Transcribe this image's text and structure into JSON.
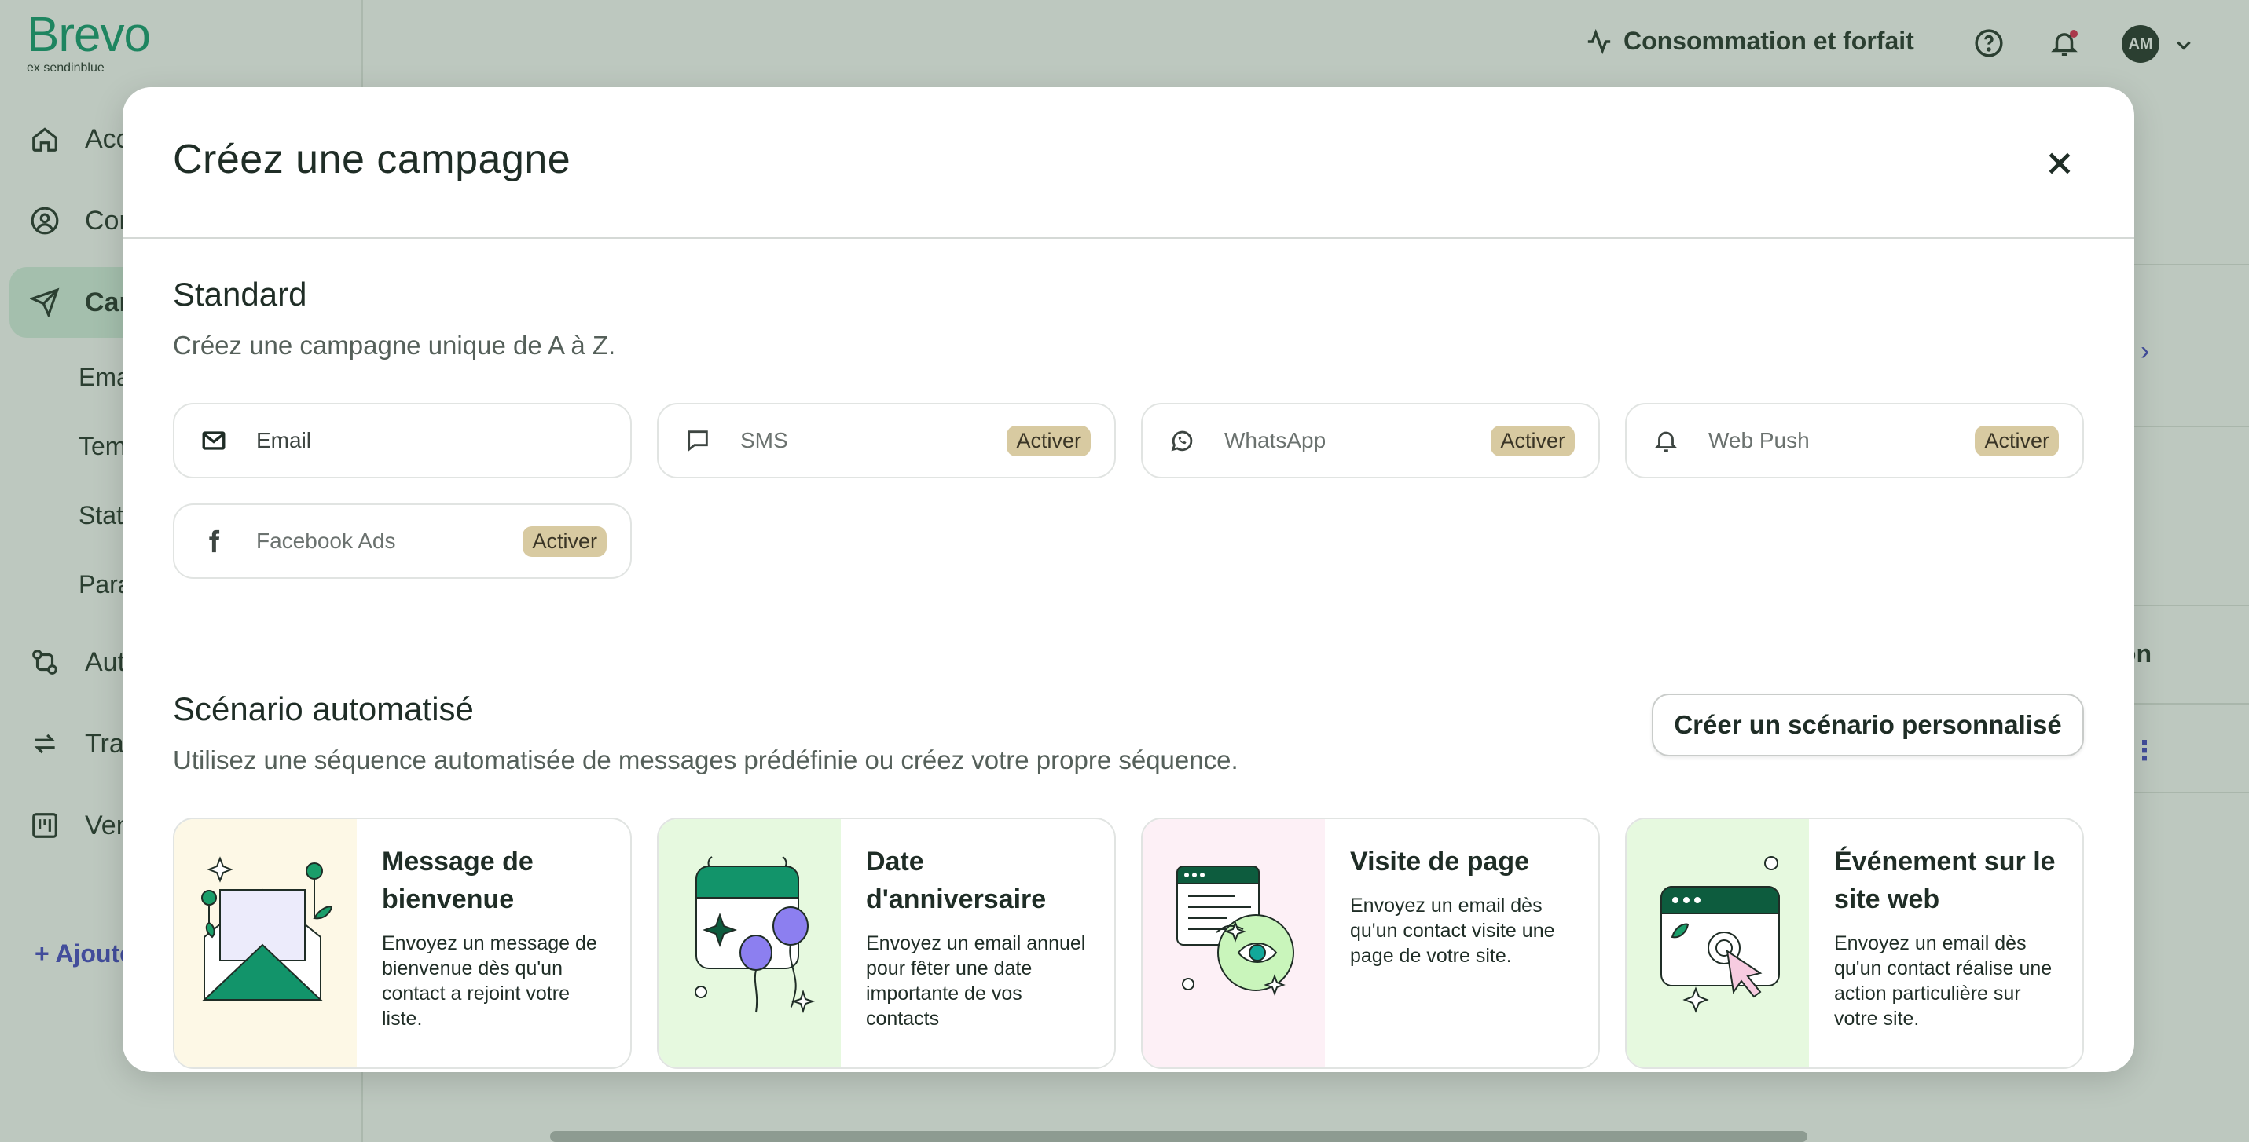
{
  "brand": {
    "name": "Brevo",
    "tagline": "ex sendinblue",
    "color": "#0b996e"
  },
  "sidebar": {
    "items": [
      {
        "label": "Accueil",
        "icon": "home-icon"
      },
      {
        "label": "Contacts",
        "icon": "user-circle-icon"
      },
      {
        "label": "Campagnes",
        "icon": "send-icon",
        "active": true
      },
      {
        "label": "Automatisations",
        "icon": "automation-icon"
      },
      {
        "label": "Transactionnel",
        "icon": "transactional-icon"
      },
      {
        "label": "Ventes",
        "icon": "sales-board-icon"
      }
    ],
    "sub_items": [
      "Emails",
      "Templates",
      "Statistiques",
      "Paramètres"
    ],
    "add_label": "+ Ajouter"
  },
  "topbar": {
    "usage_label": "Consommation et forfait",
    "avatar_initials": "AM"
  },
  "background": {
    "column_header": "ion"
  },
  "modal": {
    "title": "Créez une campagne",
    "standard": {
      "title": "Standard",
      "description": "Créez une campagne unique de A à Z.",
      "channels": [
        {
          "label": "Email",
          "icon": "envelope-icon",
          "badge": ""
        },
        {
          "label": "SMS",
          "icon": "chat-bubble-icon",
          "badge": "Activer"
        },
        {
          "label": "WhatsApp",
          "icon": "whatsapp-icon",
          "badge": "Activer"
        },
        {
          "label": "Web Push",
          "icon": "bell-icon",
          "badge": "Activer"
        },
        {
          "label": "Facebook Ads",
          "icon": "facebook-icon",
          "badge": "Activer"
        }
      ]
    },
    "automated": {
      "title": "Scénario automatisé",
      "description": "Utilisez une séquence automatisée de messages prédéfinie ou créez votre propre séquence.",
      "custom_button": "Créer un scénario personnalisé",
      "scenarios": [
        {
          "title": "Message de bienvenue",
          "description": "Envoyez un message de bienvenue dès qu'un contact a rejoint votre liste.",
          "illustration": "welcome-envelope-illustration",
          "bg": "#fdf8e6"
        },
        {
          "title": "Date d'anniversaire",
          "description": "Envoyez un email annuel pour fêter une date importante de vos contacts",
          "illustration": "birthday-calendar-illustration",
          "bg": "#e6f9df"
        },
        {
          "title": "Visite de page",
          "description": "Envoyez un email dès qu'un contact visite une page de votre site.",
          "illustration": "page-visit-eye-illustration",
          "bg": "#fdf0f6"
        },
        {
          "title": "Événement sur le site web",
          "description": "Envoyez un email dès qu'un contact réalise une action particulière sur votre site.",
          "illustration": "website-event-cursor-illustration",
          "bg": "#e6f9df"
        }
      ]
    }
  }
}
